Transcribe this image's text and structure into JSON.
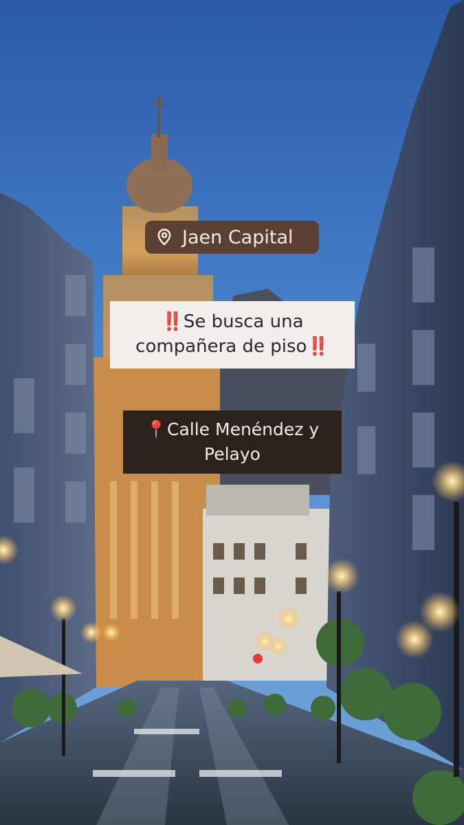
{
  "location_label": "Jaen Capital",
  "headline": {
    "prefix_mark": "‼️",
    "text": "Se busca una compañera de piso",
    "suffix_mark": "‼️"
  },
  "address": {
    "pin": "📍",
    "text": "Calle Menéndez y Pelayo"
  },
  "icons": {
    "location": "location-pin-icon"
  },
  "colors": {
    "location_badge": "#5a3f32",
    "headline_card": "#f1eeec",
    "address_card": "#2b221d",
    "alert_red": "#e0231c",
    "sky_top": "#2a5aa8"
  }
}
